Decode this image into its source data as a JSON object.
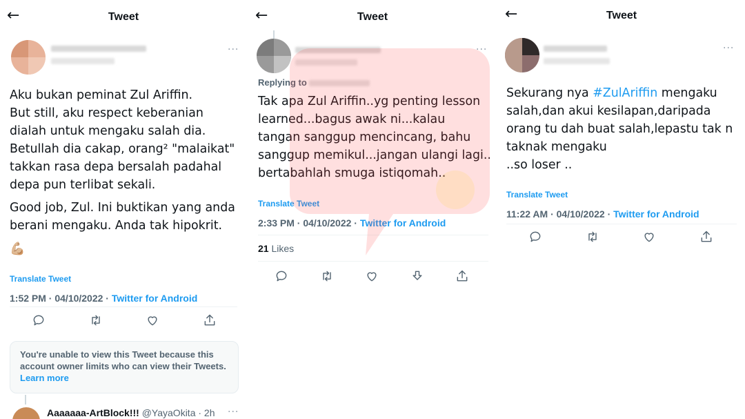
{
  "colors": {
    "accent": "#1d9bf0",
    "text": "#0f1419",
    "muted": "#536471",
    "watermark": "#ff3b3b"
  },
  "panel1": {
    "header_title": "Tweet",
    "tweet_text": "Aku bukan peminat Zul Ariffin.\nBut still, aku respect keberanian\ndialah untuk mengaku salah dia.\nBetullah dia cakap, orang² \"malaikat\"\ntakkan rasa depa bersalah padahal\ndepa pun terlibat sekali.",
    "tweet_text_2": "Good job, Zul. Ini buktikan yang anda\nberani mengaku. Anda tak hipokrit.",
    "emoji": "💪🏼",
    "translate_label": "Translate Tweet",
    "timestamp": "1:52 PM · 04/10/2022 · ",
    "source": "Twitter for Android",
    "notice_text": "You're unable to view this Tweet because this account owner limits who can view their Tweets. ",
    "notice_link": "Learn more",
    "reply_name": "Aaaaaaa-ArtBlock!!!",
    "reply_handle": "@YayaOkita · 2h",
    "icons": [
      "reply-icon",
      "retweet-icon",
      "like-icon",
      "share-icon"
    ]
  },
  "panel2": {
    "header_title": "Tweet",
    "replying_to": "Replying to",
    "tweet_text": "Tak apa  Zul Ariffin..yg penting lesson\nlearned...bagus awak ni...kalau\ntangan sanggup mencincang, bahu\nsanggup memikul...jangan ulangi lagi..\nbertabahlah smuga istiqomah..",
    "translate_label": "Translate Tweet",
    "timestamp": "2:33 PM · 04/10/2022 · ",
    "source": "Twitter for Android",
    "likes_count": "21",
    "likes_label": " Likes",
    "icons": [
      "reply-icon",
      "retweet-icon",
      "like-icon",
      "download-icon",
      "share-icon"
    ]
  },
  "panel3": {
    "header_title": "Tweet",
    "text_prefix": "Sekurang nya ",
    "hashtag": "#ZulAriffin",
    "text_rest": " mengaku\nsalah,dan akui kesilapan,daripada\norang tu dah buat salah,lepastu tak n\ntaknak mengaku\n..so loser ..",
    "translate_label": "Translate Tweet",
    "timestamp": "11:22 AM · 04/10/2022 · ",
    "source": "Twitter for Android",
    "icons": [
      "reply-icon",
      "retweet-icon",
      "like-icon",
      "share-icon"
    ]
  }
}
